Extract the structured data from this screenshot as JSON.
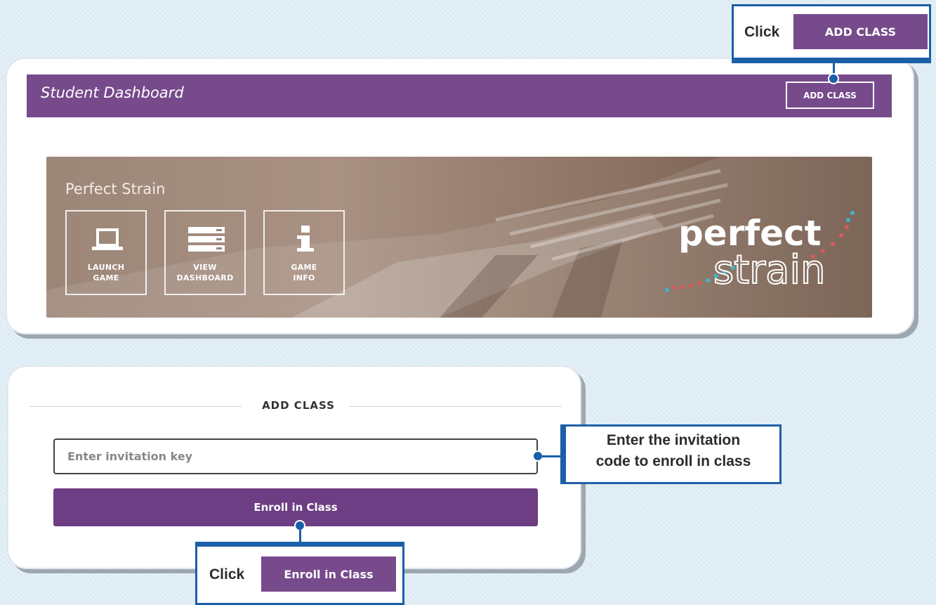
{
  "dashboard": {
    "title": "Student Dashboard",
    "add_class_button": "ADD CLASS"
  },
  "game": {
    "name": "Perfect Strain",
    "tiles": [
      {
        "label_line1": "LAUNCH",
        "label_line2": "GAME",
        "icon": "laptop-icon"
      },
      {
        "label_line1": "VIEW",
        "label_line2": "DASHBOARD",
        "icon": "server-list-icon"
      },
      {
        "label_line1": "GAME",
        "label_line2": "INFO",
        "icon": "info-icon"
      }
    ],
    "logo_word1": "perfect",
    "logo_word2": "strain"
  },
  "add_class": {
    "heading": "ADD CLASS",
    "input_placeholder": "Enter invitation key",
    "enroll_button": "Enroll in Class"
  },
  "callouts": {
    "top": {
      "word": "Click",
      "button": "ADD CLASS"
    },
    "input_tip": {
      "line1": "Enter the invitation",
      "line2": "code to enroll in class"
    },
    "bottom": {
      "word": "Click",
      "button": "Enroll in Class"
    }
  },
  "colors": {
    "brand_purple": "#774a8c",
    "callout_blue": "#1b5fa8"
  }
}
